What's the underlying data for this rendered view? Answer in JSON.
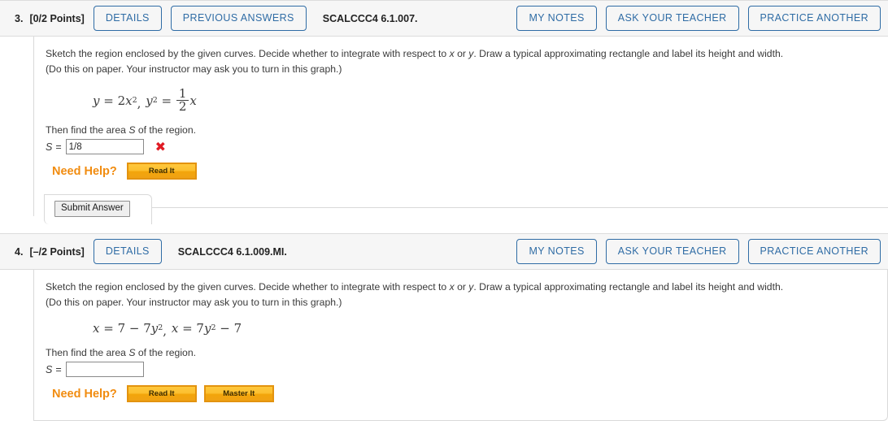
{
  "problems": [
    {
      "number": "3.",
      "points": "[0/2 Points]",
      "code": "SCALCCC4 6.1.007.",
      "details_label": "DETAILS",
      "previous_answers_label": "PREVIOUS ANSWERS",
      "my_notes_label": "MY NOTES",
      "ask_teacher_label": "ASK YOUR TEACHER",
      "practice_another_label": "PRACTICE ANOTHER",
      "prompt_line1_a": "Sketch the region enclosed by the given curves. Decide whether to integrate with respect to ",
      "prompt_line1_x": "x",
      "prompt_line1_b": " or ",
      "prompt_line1_y": "y",
      "prompt_line1_c": ". Draw a typical approximating rectangle and label its height and width.",
      "prompt_line2": "(Do this on paper. Your instructor may ask you to turn in this graph.)",
      "math": "y = 2x², y² = (1/2)x",
      "then_text_a": "Then find the area ",
      "then_text_s": "S",
      "then_text_b": " of the region.",
      "answer_label": "S",
      "answer_eq": "=",
      "answer_value": "1/8",
      "answer_placeholder": "",
      "answer_status": "incorrect",
      "status_mark": "✖",
      "need_help_label": "Need Help?",
      "help_buttons": [
        "Read It"
      ],
      "submit_label": "Submit Answer",
      "has_submit": true,
      "has_previous_answers": true
    },
    {
      "number": "4.",
      "points": "[–/2 Points]",
      "code": "SCALCCC4 6.1.009.MI.",
      "details_label": "DETAILS",
      "previous_answers_label": "",
      "my_notes_label": "MY NOTES",
      "ask_teacher_label": "ASK YOUR TEACHER",
      "practice_another_label": "PRACTICE ANOTHER",
      "prompt_line1_a": "Sketch the region enclosed by the given curves. Decide whether to integrate with respect to ",
      "prompt_line1_x": "x",
      "prompt_line1_b": " or ",
      "prompt_line1_y": "y",
      "prompt_line1_c": ". Draw a typical approximating rectangle and label its height and width.",
      "prompt_line2": "(Do this on paper. Your instructor may ask you to turn in this graph.)",
      "math": "x = 7 − 7y², x = 7y² − 7",
      "then_text_a": "Then find the area ",
      "then_text_s": "S",
      "then_text_b": " of the region.",
      "answer_label": "S",
      "answer_eq": "=",
      "answer_value": "",
      "answer_placeholder": "",
      "answer_status": "empty",
      "status_mark": "",
      "need_help_label": "Need Help?",
      "help_buttons": [
        "Read It",
        "Master It"
      ],
      "submit_label": "",
      "has_submit": false,
      "has_previous_answers": false
    }
  ],
  "colors": {
    "link_blue": "#2f6ca5",
    "header_bg": "#f6f6f6",
    "border_gray": "#d9d9d9",
    "help_orange": "#f18c10",
    "error_red": "#e01b24"
  }
}
